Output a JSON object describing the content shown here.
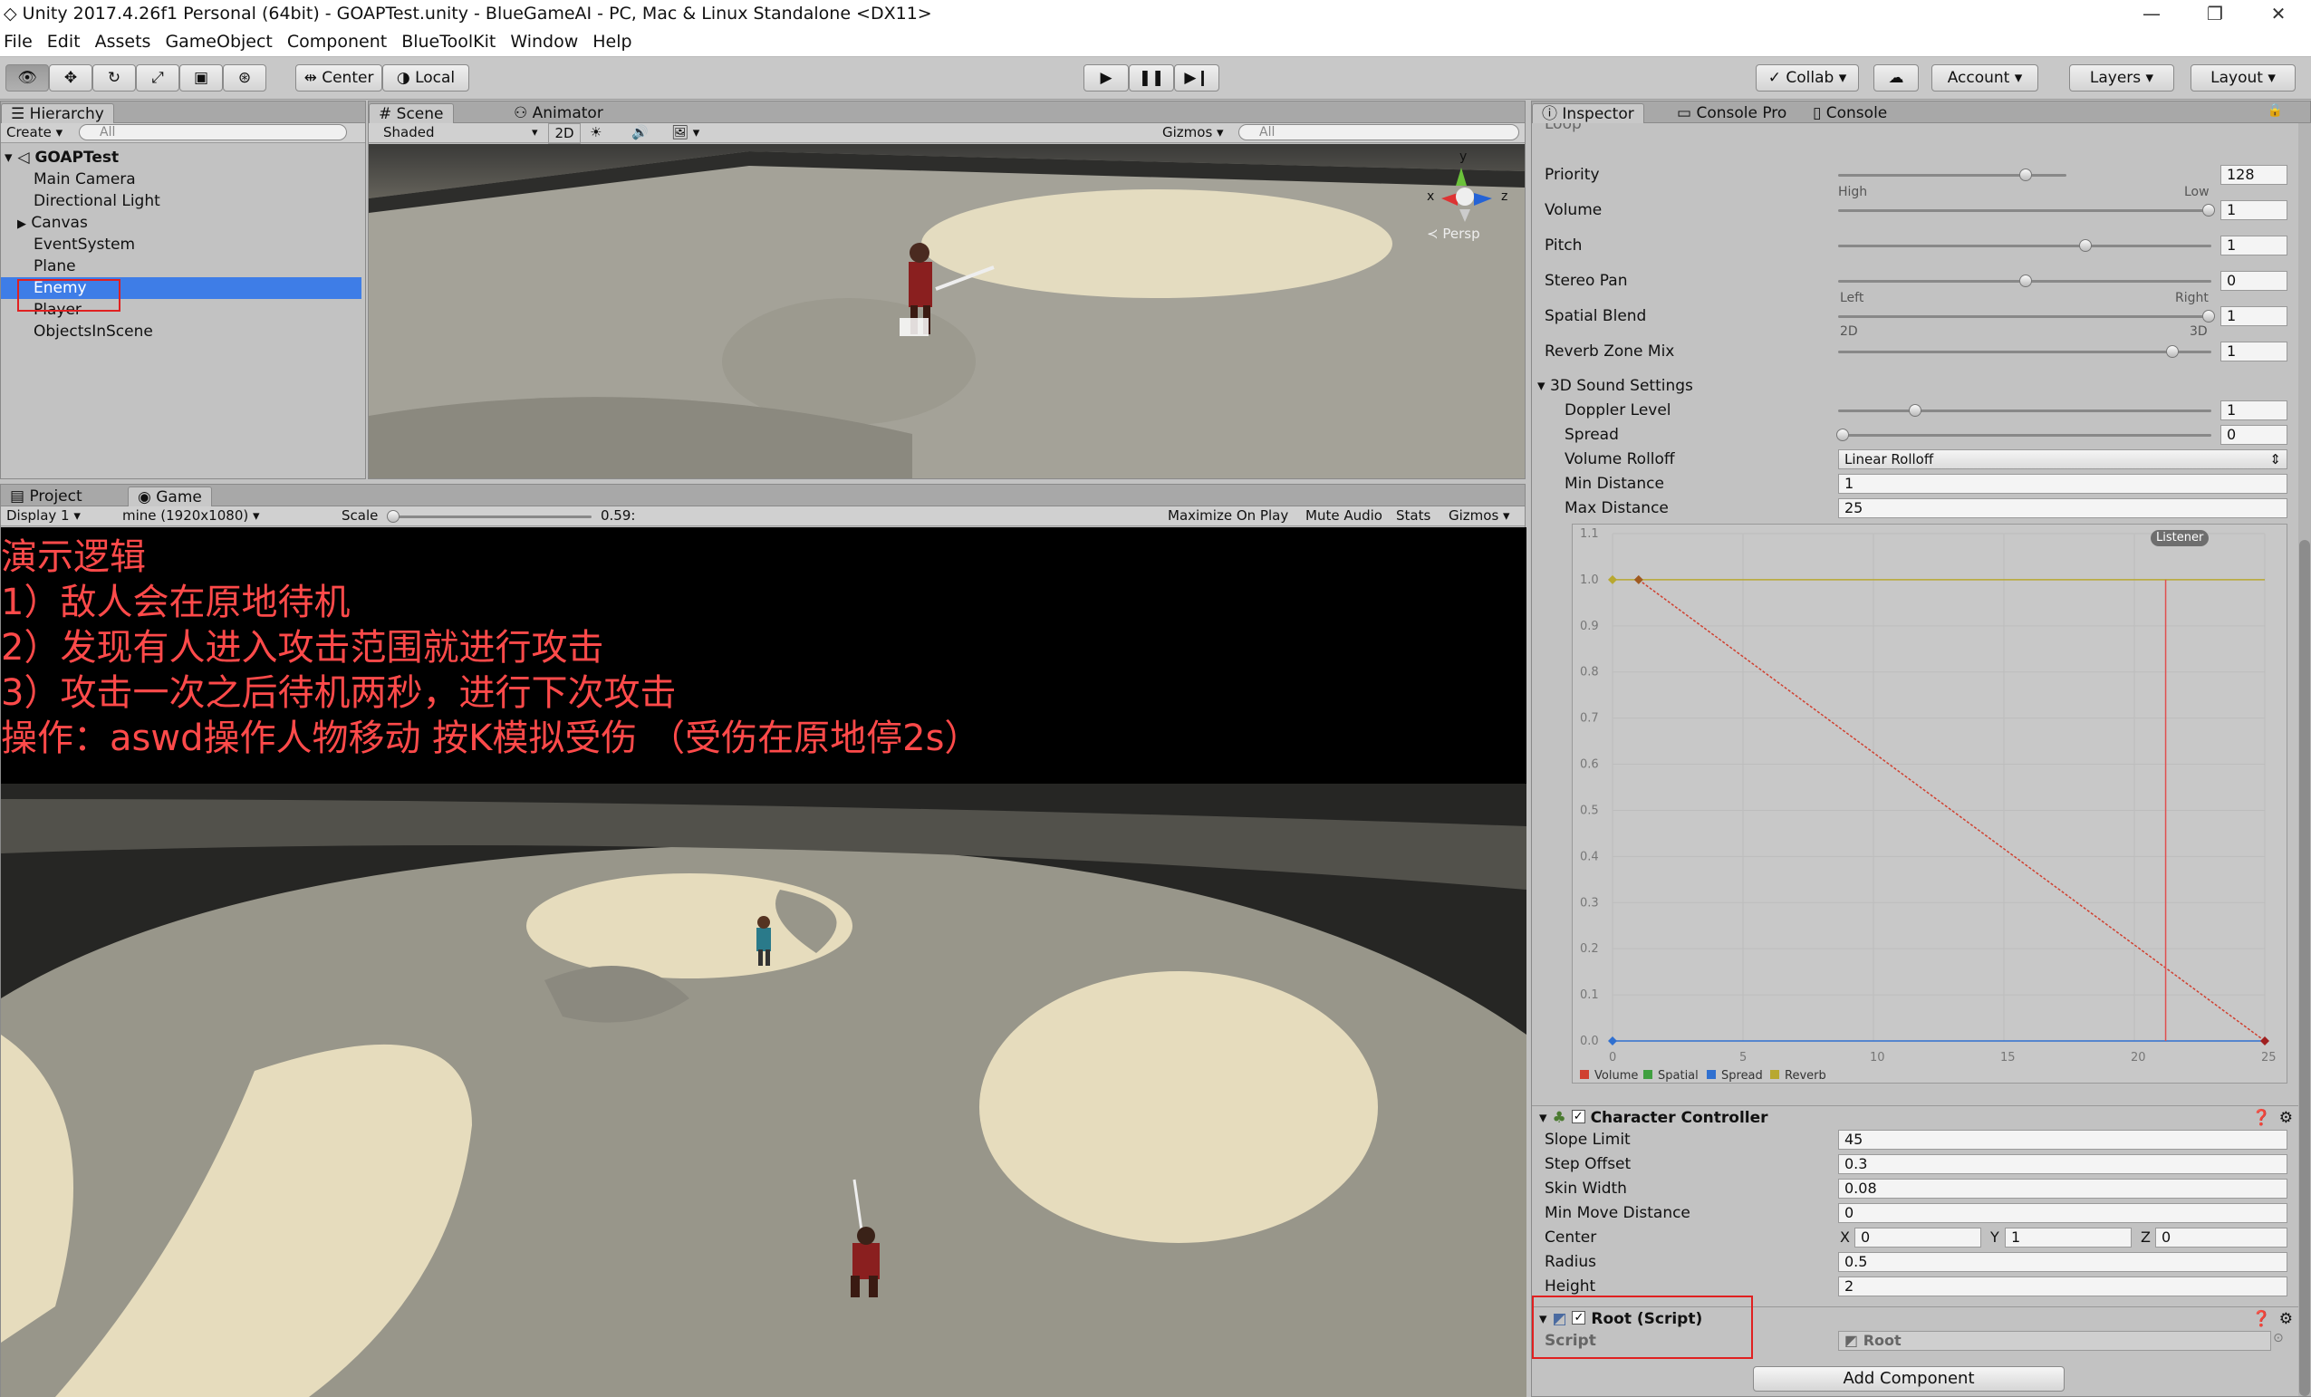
{
  "window": {
    "title": "Unity 2017.4.26f1 Personal (64bit) - GOAPTest.unity - BlueGameAI - PC, Mac & Linux Standalone <DX11>",
    "minimize": "—",
    "maximize": "❐",
    "close": "✕"
  },
  "menu": [
    "File",
    "Edit",
    "Assets",
    "GameObject",
    "Component",
    "BlueToolKit",
    "Window",
    "Help"
  ],
  "toolbar": {
    "pivot": "Center",
    "space": "Local",
    "collab": "Collab",
    "account": "Account",
    "layers": "Layers",
    "layout": "Layout"
  },
  "hierarchy": {
    "tab": "Hierarchy",
    "create": "Create",
    "search_placeholder": "All",
    "scene": "GOAPTest",
    "items": [
      "Main Camera",
      "Directional Light",
      "Canvas",
      "EventSystem",
      "Plane",
      "Enemy",
      "Player",
      "ObjectsInScene"
    ]
  },
  "scene_view": {
    "tab_scene": "Scene",
    "tab_animator": "Animator",
    "shading": "Shaded",
    "mode_2d": "2D",
    "gizmos": "Gizmos",
    "search_placeholder": "All",
    "persp": "Persp",
    "axis_y": "y",
    "axis_x": "x",
    "axis_z": "z"
  },
  "game_view": {
    "tab_project": "Project",
    "tab_game": "Game",
    "display": "Display 1",
    "resolution": "mine (1920x1080)",
    "scale_label": "Scale",
    "scale_value": "0.59:",
    "maximize": "Maximize On Play",
    "mute": "Mute Audio",
    "stats": "Stats",
    "gizmos": "Gizmos",
    "overlay_lines": [
      "演示逻辑",
      "1）敌人会在原地待机",
      "2）发现有人进入攻击范围就进行攻击",
      "3）攻击一次之后待机两秒，进行下次攻击",
      "操作：aswd操作人物移动 按K模拟受伤 （受伤在原地停2s）"
    ]
  },
  "inspector": {
    "tab_inspector": "Inspector",
    "tab_console_pro": "Console Pro",
    "tab_console": "Console",
    "cut_label": "Loop",
    "audio": {
      "priority": {
        "label": "Priority",
        "value": "128",
        "min": "High",
        "max": "Low",
        "pos": 0.5
      },
      "volume": {
        "label": "Volume",
        "value": "1",
        "pos": 1.0
      },
      "pitch": {
        "label": "Pitch",
        "value": "1",
        "pos": 0.66
      },
      "stereo_pan": {
        "label": "Stereo Pan",
        "value": "0",
        "min": "Left",
        "max": "Right",
        "pos": 0.5
      },
      "spatial_blend": {
        "label": "Spatial Blend",
        "value": "1",
        "min": "2D",
        "max": "3D",
        "pos": 1.0
      },
      "reverb_zone_mix": {
        "label": "Reverb Zone Mix",
        "value": "1",
        "pos": 0.9
      },
      "sound3d_header": "3D Sound Settings",
      "doppler": {
        "label": "Doppler Level",
        "value": "1",
        "pos": 0.2
      },
      "spread": {
        "label": "Spread",
        "value": "0",
        "pos": 0.0
      },
      "rolloff": {
        "label": "Volume Rolloff",
        "value": "Linear Rolloff"
      },
      "min_distance": {
        "label": "Min Distance",
        "value": "1"
      },
      "max_distance": {
        "label": "Max Distance",
        "value": "25"
      }
    },
    "curve": {
      "listener": "Listener",
      "y_ticks": [
        "1.1",
        "1.0",
        "0.9",
        "0.8",
        "0.7",
        "0.6",
        "0.5",
        "0.4",
        "0.3",
        "0.2",
        "0.1",
        "0.0"
      ],
      "x_ticks": [
        "0",
        "5",
        "10",
        "15",
        "20",
        "25"
      ],
      "legend": [
        "Volume",
        "Spatial",
        "Spread",
        "Reverb"
      ],
      "colors": {
        "volume": "#d04030",
        "spatial": "#40a040",
        "spread": "#3070d0",
        "reverb": "#b8a830"
      }
    },
    "character_controller": {
      "title": "Character Controller",
      "fields": [
        {
          "label": "Slope Limit",
          "value": "45"
        },
        {
          "label": "Step Offset",
          "value": "0.3"
        },
        {
          "label": "Skin Width",
          "value": "0.08"
        },
        {
          "label": "Min Move Distance",
          "value": "0"
        }
      ],
      "center_label": "Center",
      "center": {
        "x": "0",
        "y": "1",
        "z": "0"
      },
      "radius": {
        "label": "Radius",
        "value": "0.5"
      },
      "height": {
        "label": "Height",
        "value": "2"
      }
    },
    "root_script": {
      "title": "Root (Script)",
      "script_label": "Script",
      "script_value": "Root"
    },
    "add_component": "Add Component"
  }
}
